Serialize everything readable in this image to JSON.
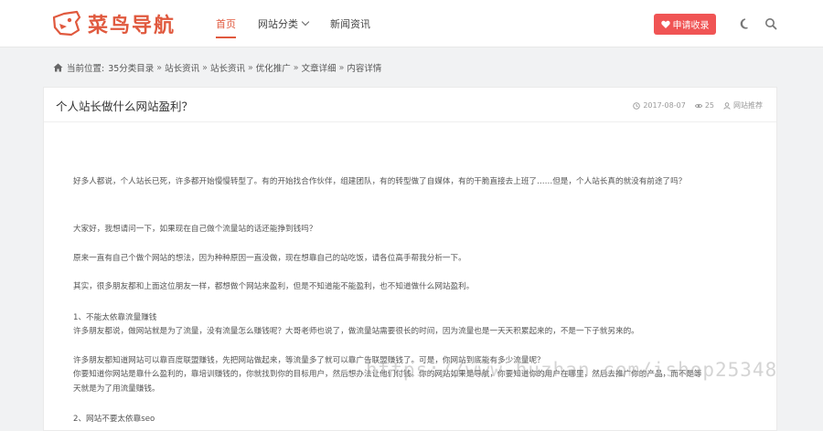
{
  "header": {
    "logo_text": "菜鸟导航",
    "nav": [
      {
        "label": "首页",
        "active": true
      },
      {
        "label": "网站分类",
        "active": false,
        "has_dropdown": true
      },
      {
        "label": "新闻资讯",
        "active": false
      }
    ],
    "apply_label": "申请收录",
    "icons": [
      "moon-icon",
      "search-icon"
    ],
    "accent_color": "#e0593e",
    "apply_color": "#f05454"
  },
  "breadcrumb": {
    "prefix": "当前位置:",
    "items": [
      "35分类目录",
      "站长资讯",
      "站长资讯",
      "优化推广",
      "文章详细",
      "内容详情"
    ],
    "separator": "»"
  },
  "article": {
    "title": "个人站长做什么网站盈利？",
    "date": "2017-08-07",
    "views": "25",
    "author": "网站推荐",
    "paragraphs": [
      "好多人都说，个人站长已死，许多都开始慢慢转型了。有的开始找合作伙伴，组建团队，有的转型做了自媒体，有的干脆直接去上班了……但是，个人站长真的就没有前途了吗？",
      "大家好，我想请问一下，如果现在自己做个流量站的话还能挣到钱吗？",
      "原来一直有自己个做个网站的想法，因为种种原因一直没做，现在想靠自己的站吃饭，请各位高手帮我分析一下。",
      "其实，很多朋友都和上面这位朋友一样，都想做个网站来盈利，但是不知道能不能盈利，也不知道做什么网站盈利。",
      "1、不能太依靠流量赚钱",
      "许多朋友都说，做网站就是为了流量，没有流量怎么赚钱呢？大哥老师也说了，做流量站需要很长的时间，因为流量也是一天天积累起来的，不是一下子就另来的。",
      "许多朋友都知道网站可以靠百度联盟赚钱，先把网站做起来，等流量多了就可以靠广告联盟赚钱了。可是，你网站到底能有多少流量呢？",
      "你要知道你网站是靠什么盈利的，靠培训赚钱的，你就找到你的目标用户，然后想办法让他们付钱。你的网站如果是导航，你要知道你的用户在哪里，然后去推广你的产品，而不是等",
      "天就是为了用流量赚钱。",
      "2、网站不要太依靠seo"
    ]
  },
  "watermark": "https://www.huzhan.com/ishop25348"
}
